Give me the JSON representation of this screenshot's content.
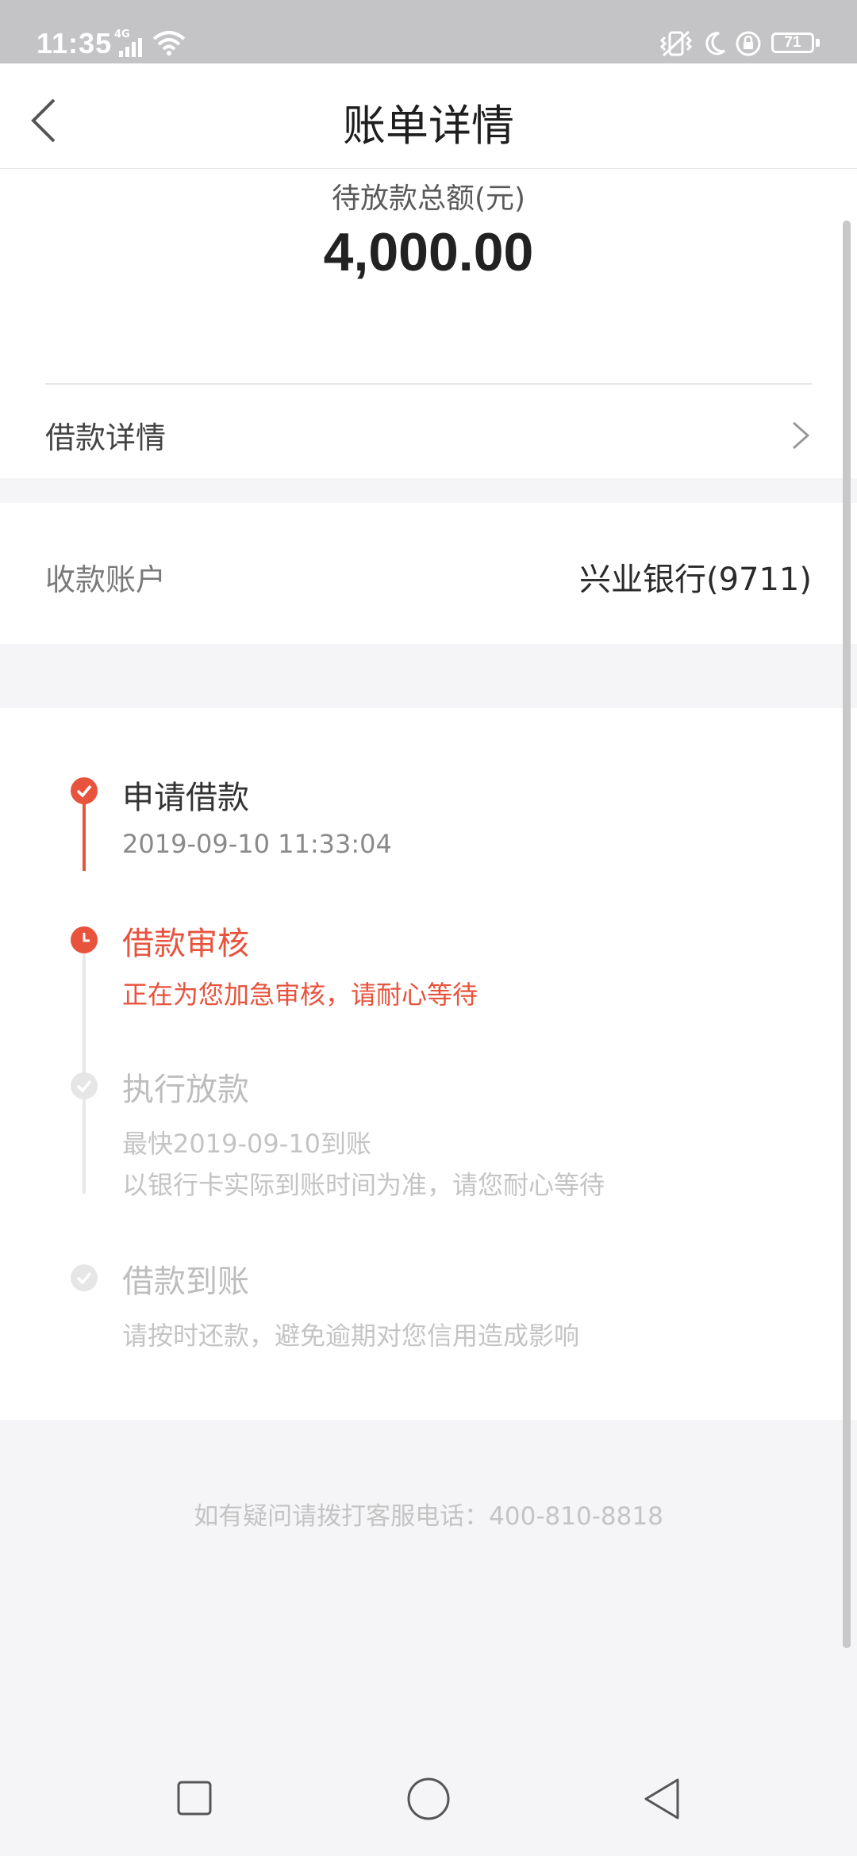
{
  "status_bar": {
    "time": "11:35",
    "network": "4G",
    "battery": "71"
  },
  "header": {
    "title": "账单详情",
    "back_icon": "chevron-left-icon"
  },
  "amount": {
    "label": "待放款总额(元)",
    "value": "4,000.00"
  },
  "loan_detail": {
    "label": "借款详情"
  },
  "account": {
    "label": "收款账户",
    "value": "兴业银行(9711)"
  },
  "timeline": [
    {
      "title": "申请借款",
      "lines": [
        "2019-09-10 11:33:04"
      ],
      "state": "done"
    },
    {
      "title": "借款审核",
      "lines": [
        "正在为您加急审核，请耐心等待"
      ],
      "state": "current"
    },
    {
      "title": "执行放款",
      "lines": [
        "最快2019-09-10到账",
        "以银行卡实际到账时间为准，请您耐心等待"
      ],
      "state": "pending"
    },
    {
      "title": "借款到账",
      "lines": [
        "请按时还款，避免逾期对您信用造成影响"
      ],
      "state": "pending"
    }
  ],
  "footer": {
    "hotline": "如有疑问请拨打客服电话：400-810-8818"
  },
  "colors": {
    "accent": "#e8533d",
    "inactive": "#d8d8d8",
    "status_bar": "#c4c4c6"
  }
}
